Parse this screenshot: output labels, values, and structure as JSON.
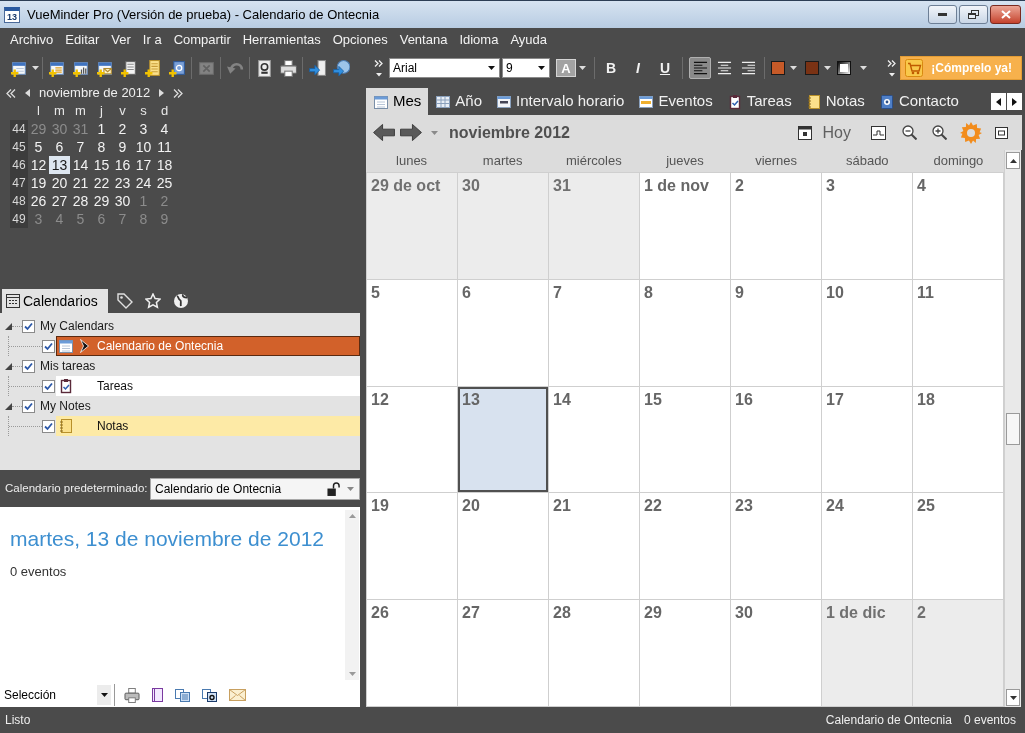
{
  "window": {
    "icon_label": "13",
    "title": "VueMinder Pro (Versión de prueba) - Calendario de Ontecnia"
  },
  "menu_bar": [
    "Archivo",
    "Editar",
    "Ver",
    "Ir a",
    "Compartir",
    "Herramientas",
    "Opciones",
    "Ventana",
    "Idioma",
    "Ayuda"
  ],
  "toolbar": [
    {
      "kind": "new-event",
      "disabled": false
    },
    {
      "kind": "menu-arrow",
      "disabled": false
    },
    {
      "kind": "separator"
    },
    {
      "kind": "new-list",
      "disabled": false
    },
    {
      "kind": "new-chart",
      "disabled": false
    },
    {
      "kind": "new-mail",
      "disabled": false
    },
    {
      "kind": "new-task",
      "disabled": false
    },
    {
      "kind": "new-note",
      "disabled": false
    },
    {
      "kind": "new-contact",
      "disabled": false
    },
    {
      "kind": "separator"
    },
    {
      "kind": "delete",
      "disabled": true
    },
    {
      "kind": "separator"
    },
    {
      "kind": "undo",
      "disabled": true
    },
    {
      "kind": "separator"
    },
    {
      "kind": "preview",
      "disabled": false
    },
    {
      "kind": "print",
      "disabled": false
    },
    {
      "kind": "separator"
    },
    {
      "kind": "import",
      "disabled": false
    },
    {
      "kind": "publish",
      "disabled": false
    }
  ],
  "format_bar": {
    "font": "Arial",
    "size": "9",
    "buttons": [
      {
        "kind": "font-color",
        "label": "A"
      },
      {
        "kind": "bold",
        "label": "B"
      },
      {
        "kind": "italic",
        "label": "I"
      },
      {
        "kind": "underline",
        "label": "U"
      }
    ],
    "alignments": [
      {
        "kind": "left",
        "selected": true
      },
      {
        "kind": "center",
        "selected": false
      },
      {
        "kind": "right",
        "selected": false
      }
    ],
    "colors": [
      {
        "color": "#c65a28"
      },
      {
        "color": "#7a3214"
      }
    ]
  },
  "buy_button": "¡Cómprelo ya!",
  "mini_calendar": {
    "title": "noviembre de 2012",
    "weekdays": [
      "l",
      "m",
      "m",
      "j",
      "v",
      "s",
      "d"
    ],
    "weeks": [
      {
        "number": "44",
        "days": [
          {
            "day": "29",
            "in_month": false,
            "selected": false
          },
          {
            "day": "30",
            "in_month": false,
            "selected": false
          },
          {
            "day": "31",
            "in_month": false,
            "selected": false
          },
          {
            "day": "1",
            "in_month": true,
            "selected": false
          },
          {
            "day": "2",
            "in_month": true,
            "selected": false
          },
          {
            "day": "3",
            "in_month": true,
            "selected": false
          },
          {
            "day": "4",
            "in_month": true,
            "selected": false
          }
        ]
      },
      {
        "number": "45",
        "days": [
          {
            "day": "5",
            "in_month": true,
            "selected": false
          },
          {
            "day": "6",
            "in_month": true,
            "selected": false
          },
          {
            "day": "7",
            "in_month": true,
            "selected": false
          },
          {
            "day": "8",
            "in_month": true,
            "selected": false
          },
          {
            "day": "9",
            "in_month": true,
            "selected": false
          },
          {
            "day": "10",
            "in_month": true,
            "selected": false
          },
          {
            "day": "11",
            "in_month": true,
            "selected": false
          }
        ]
      },
      {
        "number": "46",
        "days": [
          {
            "day": "12",
            "in_month": true,
            "selected": false
          },
          {
            "day": "13",
            "in_month": true,
            "selected": true
          },
          {
            "day": "14",
            "in_month": true,
            "selected": false
          },
          {
            "day": "15",
            "in_month": true,
            "selected": false
          },
          {
            "day": "16",
            "in_month": true,
            "selected": false
          },
          {
            "day": "17",
            "in_month": true,
            "selected": false
          },
          {
            "day": "18",
            "in_month": true,
            "selected": false
          }
        ]
      },
      {
        "number": "47",
        "days": [
          {
            "day": "19",
            "in_month": true,
            "selected": false
          },
          {
            "day": "20",
            "in_month": true,
            "selected": false
          },
          {
            "day": "21",
            "in_month": true,
            "selected": false
          },
          {
            "day": "22",
            "in_month": true,
            "selected": false
          },
          {
            "day": "23",
            "in_month": true,
            "selected": false
          },
          {
            "day": "24",
            "in_month": true,
            "selected": false
          },
          {
            "day": "25",
            "in_month": true,
            "selected": false
          }
        ]
      },
      {
        "number": "48",
        "days": [
          {
            "day": "26",
            "in_month": true,
            "selected": false
          },
          {
            "day": "27",
            "in_month": true,
            "selected": false
          },
          {
            "day": "28",
            "in_month": true,
            "selected": false
          },
          {
            "day": "29",
            "in_month": true,
            "selected": false
          },
          {
            "day": "30",
            "in_month": true,
            "selected": false
          },
          {
            "day": "1",
            "in_month": false,
            "selected": false
          },
          {
            "day": "2",
            "in_month": false,
            "selected": false
          }
        ]
      },
      {
        "number": "49",
        "days": [
          {
            "day": "3",
            "in_month": false,
            "selected": false
          },
          {
            "day": "4",
            "in_month": false,
            "selected": false
          },
          {
            "day": "5",
            "in_month": false,
            "selected": false
          },
          {
            "day": "6",
            "in_month": false,
            "selected": false
          },
          {
            "day": "7",
            "in_month": false,
            "selected": false
          },
          {
            "day": "8",
            "in_month": false,
            "selected": false
          },
          {
            "day": "9",
            "in_month": false,
            "selected": false
          }
        ]
      }
    ]
  },
  "sidebar_tabs": [
    {
      "kind": "calendars",
      "label": "Calendarios",
      "selected": true
    },
    {
      "kind": "tags",
      "selected": false
    },
    {
      "kind": "favorites",
      "selected": false
    },
    {
      "kind": "online",
      "selected": false
    }
  ],
  "calendar_tree": [
    {
      "label": "My Calendars",
      "checked": true,
      "expanded": true,
      "selected": false,
      "children": [
        {
          "label": "Calendario de Ontecnia",
          "kind": "calendar",
          "checked": true,
          "selected": true,
          "color": "#d2612a"
        }
      ]
    },
    {
      "label": "Mis tareas",
      "checked": true,
      "expanded": true,
      "selected": false,
      "children": [
        {
          "label": "Tareas",
          "kind": "tasks",
          "checked": true,
          "selected": false,
          "color": "#ffffff"
        }
      ]
    },
    {
      "label": "My Notes",
      "checked": true,
      "expanded": true,
      "selected": false,
      "children": [
        {
          "label": "Notas",
          "kind": "notes",
          "checked": true,
          "selected": false,
          "color": "#fdeaa6"
        }
      ]
    }
  ],
  "default_calendar": {
    "label": "Calendario predeterminado:",
    "value": "Calendario de Ontecnia"
  },
  "day_panel": {
    "date": "martes, 13 de noviembre de 2012",
    "summary": "0 eventos",
    "view_select": "Selección"
  },
  "view_tabs": [
    {
      "kind": "month",
      "label": "Mes",
      "selected": true
    },
    {
      "kind": "year",
      "label": "Año",
      "selected": false
    },
    {
      "kind": "timeline",
      "label": "Intervalo horario",
      "selected": false
    },
    {
      "kind": "events",
      "label": "Eventos",
      "selected": false
    },
    {
      "kind": "tasks",
      "label": "Tareas",
      "selected": false
    },
    {
      "kind": "notes",
      "label": "Notas",
      "selected": false
    },
    {
      "kind": "contacts",
      "label": "Contacto",
      "selected": false
    }
  ],
  "month_view": {
    "title": "noviembre 2012",
    "today_button": "Hoy",
    "weekdays": [
      "lunes",
      "martes",
      "miércoles",
      "jueves",
      "viernes",
      "sábado",
      "domingo"
    ],
    "weeks": [
      {
        "days": [
          {
            "label": "29 de oct",
            "in_month": false,
            "selected": false
          },
          {
            "label": "30",
            "in_month": false,
            "selected": false
          },
          {
            "label": "31",
            "in_month": false,
            "selected": false
          },
          {
            "label": "1 de nov",
            "in_month": true,
            "selected": false
          },
          {
            "label": "2",
            "in_month": true,
            "selected": false
          },
          {
            "label": "3",
            "in_month": true,
            "selected": false
          },
          {
            "label": "4",
            "in_month": true,
            "selected": false
          }
        ]
      },
      {
        "days": [
          {
            "label": "5",
            "in_month": true,
            "selected": false
          },
          {
            "label": "6",
            "in_month": true,
            "selected": false
          },
          {
            "label": "7",
            "in_month": true,
            "selected": false
          },
          {
            "label": "8",
            "in_month": true,
            "selected": false
          },
          {
            "label": "9",
            "in_month": true,
            "selected": false
          },
          {
            "label": "10",
            "in_month": true,
            "selected": false
          },
          {
            "label": "11",
            "in_month": true,
            "selected": false
          }
        ]
      },
      {
        "days": [
          {
            "label": "12",
            "in_month": true,
            "selected": false
          },
          {
            "label": "13",
            "in_month": true,
            "selected": true
          },
          {
            "label": "14",
            "in_month": true,
            "selected": false
          },
          {
            "label": "15",
            "in_month": true,
            "selected": false
          },
          {
            "label": "16",
            "in_month": true,
            "selected": false
          },
          {
            "label": "17",
            "in_month": true,
            "selected": false
          },
          {
            "label": "18",
            "in_month": true,
            "selected": false
          }
        ]
      },
      {
        "days": [
          {
            "label": "19",
            "in_month": true,
            "selected": false
          },
          {
            "label": "20",
            "in_month": true,
            "selected": false
          },
          {
            "label": "21",
            "in_month": true,
            "selected": false
          },
          {
            "label": "22",
            "in_month": true,
            "selected": false
          },
          {
            "label": "23",
            "in_month": true,
            "selected": false
          },
          {
            "label": "24",
            "in_month": true,
            "selected": false
          },
          {
            "label": "25",
            "in_month": true,
            "selected": false
          }
        ]
      },
      {
        "days": [
          {
            "label": "26",
            "in_month": true,
            "selected": false
          },
          {
            "label": "27",
            "in_month": true,
            "selected": false
          },
          {
            "label": "28",
            "in_month": true,
            "selected": false
          },
          {
            "label": "29",
            "in_month": true,
            "selected": false
          },
          {
            "label": "30",
            "in_month": true,
            "selected": false
          },
          {
            "label": "1 de dic",
            "in_month": false,
            "selected": false
          },
          {
            "label": "2",
            "in_month": false,
            "selected": false
          }
        ]
      }
    ]
  },
  "status_bar": {
    "message": "Listo",
    "calendar": "Calendario de Ontecnia",
    "count": "0 eventos"
  }
}
